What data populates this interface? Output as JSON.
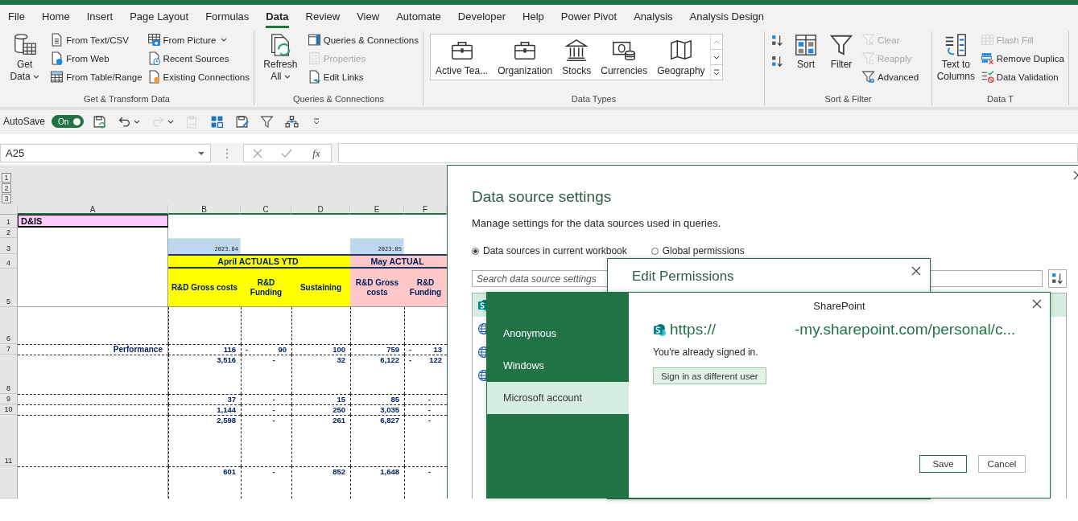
{
  "ribbon_tabs": [
    {
      "label": "File",
      "selected": false
    },
    {
      "label": "Home",
      "selected": false
    },
    {
      "label": "Insert",
      "selected": false
    },
    {
      "label": "Page Layout",
      "selected": false
    },
    {
      "label": "Formulas",
      "selected": false
    },
    {
      "label": "Data",
      "selected": true
    },
    {
      "label": "Review",
      "selected": false
    },
    {
      "label": "View",
      "selected": false
    },
    {
      "label": "Automate",
      "selected": false
    },
    {
      "label": "Developer",
      "selected": false
    },
    {
      "label": "Help",
      "selected": false
    },
    {
      "label": "Power Pivot",
      "selected": false
    },
    {
      "label": "Analysis",
      "selected": false
    },
    {
      "label": "Analysis Design",
      "selected": false
    }
  ],
  "ribbon_groups": [
    {
      "label": "Get & Transform Data",
      "items": [
        {
          "kind": "large",
          "label": "Get Data",
          "dropdown": true,
          "disabled": false
        },
        {
          "kind": "small",
          "label": "From Text/CSV",
          "disabled": false
        },
        {
          "kind": "small",
          "label": "From Web",
          "disabled": false
        },
        {
          "kind": "small",
          "label": "From Table/Range",
          "disabled": false
        },
        {
          "kind": "small",
          "label": "From Picture",
          "dropdown": true,
          "disabled": false
        },
        {
          "kind": "small",
          "label": "Recent Sources",
          "disabled": false
        },
        {
          "kind": "small",
          "label": "Existing Connections",
          "disabled": false
        }
      ]
    },
    {
      "label": "Queries & Connections",
      "items": [
        {
          "kind": "large",
          "label": "Refresh All",
          "dropdown": true,
          "disabled": false
        },
        {
          "kind": "small",
          "label": "Queries & Connections",
          "disabled": false
        },
        {
          "kind": "small",
          "label": "Properties",
          "disabled": true
        },
        {
          "kind": "small",
          "label": "Edit Links",
          "disabled": false
        }
      ]
    },
    {
      "label": "Data Types",
      "items": [
        {
          "kind": "gallery",
          "label": "Active Tea...",
          "disabled": false
        },
        {
          "kind": "gallery",
          "label": "Organization",
          "disabled": false
        },
        {
          "kind": "gallery",
          "label": "Stocks",
          "disabled": false
        },
        {
          "kind": "gallery",
          "label": "Currencies",
          "disabled": false
        },
        {
          "kind": "gallery",
          "label": "Geography",
          "disabled": false
        }
      ]
    },
    {
      "label": "Sort & Filter",
      "items": [
        {
          "kind": "icon",
          "disabled": false
        },
        {
          "kind": "icon",
          "disabled": false
        },
        {
          "kind": "large",
          "label": "Sort",
          "disabled": false
        },
        {
          "kind": "large",
          "label": "Filter",
          "disabled": false
        },
        {
          "kind": "small",
          "label": "Clear",
          "disabled": true
        },
        {
          "kind": "small",
          "label": "Reapply",
          "disabled": true
        },
        {
          "kind": "small",
          "label": "Advanced",
          "disabled": false
        }
      ]
    },
    {
      "label": "Data T",
      "items": [
        {
          "kind": "large",
          "label": "Text to Columns",
          "disabled": false
        },
        {
          "kind": "small",
          "label": "Flash Fill",
          "disabled": true
        },
        {
          "kind": "small",
          "label": "Remove Duplica",
          "disabled": false
        },
        {
          "kind": "small",
          "label": "Data Validation",
          "disabled": false
        }
      ]
    }
  ],
  "quick_access": {
    "autosave_label": "AutoSave",
    "toggle": {
      "label": "On",
      "on": true
    },
    "tools": [
      {
        "disabled": false
      },
      {
        "disabled": false,
        "dropdown": true
      },
      {
        "disabled": true,
        "dropdown": true
      },
      {
        "disabled": true
      },
      {
        "disabled": false
      },
      {
        "disabled": false
      },
      {
        "disabled": false
      },
      {
        "disabled": false
      }
    ]
  },
  "formula_bar": {
    "name_box": "A25",
    "function_label": "fx"
  },
  "sheet": {
    "outline_levels": [
      "1",
      "2",
      "3"
    ],
    "columns": [
      {
        "label": "A"
      },
      {
        "label": "B"
      },
      {
        "label": "C"
      },
      {
        "label": "D"
      },
      {
        "label": "E"
      },
      {
        "label": "F"
      }
    ],
    "rows": [
      {
        "number": "1",
        "cells": {
          "A": {
            "kind": "title",
            "text": "D&IS",
            "color": "#ffccff"
          }
        }
      },
      {
        "number": "2"
      },
      {
        "number": "3",
        "cells": {
          "B": {
            "kind": "date",
            "text": "2023.04",
            "color": "#bdd7ee"
          },
          "E": {
            "kind": "date",
            "text": "2023.05",
            "color": "#bdd7ee"
          }
        }
      },
      {
        "number": "4",
        "cells": {
          "B": {
            "kind": "band",
            "text": "April ACTUALS YTD",
            "color": "#ffff00",
            "merged": true
          },
          "E": {
            "kind": "band",
            "text": "May ACTUAL",
            "color": "#ffc7c7",
            "merged": true
          }
        }
      },
      {
        "number": "5",
        "cells": {
          "B": {
            "kind": "head",
            "text": "R&D Gross costs",
            "color": "#ffff00"
          },
          "C": {
            "kind": "head",
            "text": "R&D Funding",
            "color": "#ffff00"
          },
          "D": {
            "kind": "head",
            "text": "Sustaining",
            "color": "#ffff00"
          },
          "E": {
            "kind": "head",
            "text": "R&D Gross costs",
            "color": "#ffc7c7"
          },
          "F": {
            "kind": "head",
            "text": "R&D Funding",
            "color": "#ffc7c7"
          }
        }
      },
      {
        "number": "6"
      },
      {
        "number": "7",
        "cells": {
          "A": {
            "kind": "label",
            "text": "Performance"
          },
          "B": {
            "kind": "value",
            "text": "116"
          },
          "C": {
            "kind": "value",
            "sign": "-",
            "text": "90"
          },
          "D": {
            "kind": "value",
            "text": "100"
          },
          "E": {
            "kind": "value",
            "text": "759"
          },
          "F": {
            "kind": "value",
            "sign": "-",
            "text": "13"
          }
        }
      },
      {
        "number": "8",
        "cells": {
          "B": {
            "kind": "value",
            "text": "3,516"
          },
          "C": {
            "kind": "zero",
            "text": "-"
          },
          "D": {
            "kind": "value",
            "text": "32"
          },
          "E": {
            "kind": "value",
            "text": "6,122"
          },
          "F": {
            "kind": "value",
            "sign": "-",
            "text": "122"
          }
        }
      },
      {
        "number": "9",
        "cells": {
          "B": {
            "kind": "value",
            "text": "37"
          },
          "C": {
            "kind": "zero",
            "text": "-"
          },
          "D": {
            "kind": "value",
            "text": "15"
          },
          "E": {
            "kind": "value",
            "text": "85"
          },
          "F": {
            "kind": "zero",
            "text": "-"
          }
        }
      },
      {
        "number": "10",
        "cells": {
          "B": {
            "kind": "value",
            "text": "1,144"
          },
          "C": {
            "kind": "zero",
            "text": "-"
          },
          "D": {
            "kind": "value",
            "text": "250"
          },
          "E": {
            "kind": "value",
            "text": "3,035"
          },
          "F": {
            "kind": "zero",
            "text": "-"
          }
        }
      },
      {
        "number": "11",
        "cells": {
          "B": {
            "kind": "value",
            "text": "2,598"
          },
          "C": {
            "kind": "zero",
            "text": "-"
          },
          "D": {
            "kind": "value",
            "text": "261"
          },
          "E": {
            "kind": "value",
            "text": "6,827"
          },
          "F": {
            "kind": "zero",
            "text": "-"
          }
        }
      },
      {
        "cells": {
          "B": {
            "kind": "value",
            "text": "601"
          },
          "C": {
            "kind": "zero",
            "text": "-"
          },
          "D": {
            "kind": "value",
            "text": "852"
          },
          "E": {
            "kind": "value",
            "text": "1,648"
          },
          "F": {
            "kind": "zero",
            "text": "-"
          }
        }
      }
    ]
  },
  "data_source_settings": {
    "title": "Data source settings",
    "description": "Manage settings for the data sources used in queries.",
    "scopes": [
      {
        "label": "Data sources in current workbook",
        "selected": true
      },
      {
        "label": "Global permissions",
        "selected": false
      }
    ],
    "search": {
      "placeholder": "Search data source settings"
    },
    "sources": [
      {
        "kind": "sharepoint",
        "selected": true
      },
      {
        "kind": "web",
        "selected": false
      },
      {
        "kind": "web",
        "selected": false
      },
      {
        "kind": "web",
        "selected": false
      }
    ]
  },
  "edit_permissions": {
    "title": "Edit Permissions"
  },
  "credentials": {
    "title": "SharePoint",
    "methods": [
      {
        "label": "Anonymous",
        "selected": false
      },
      {
        "label": "Windows",
        "selected": false
      },
      {
        "label": "Microsoft account",
        "selected": true
      }
    ],
    "url_start": "https://",
    "url_end": "-my.sharepoint.com/personal/c...",
    "status": "You're already signed in.",
    "switch_button": "Sign in as different user",
    "buttons": [
      {
        "label": "Save",
        "kind": "primary"
      },
      {
        "label": "Cancel",
        "kind": "secondary"
      }
    ]
  }
}
